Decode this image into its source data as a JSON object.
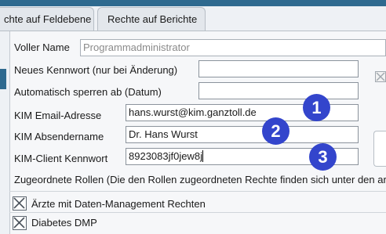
{
  "tabs": [
    {
      "label": "chte auf Feldebene"
    },
    {
      "label": "Rechte auf Berichte"
    }
  ],
  "form": {
    "voller_name": {
      "label": "Voller Name",
      "value": "Programmadministrator"
    },
    "neues_kennwort": {
      "label": "Neues Kennwort (nur bei Änderung)",
      "value": ""
    },
    "automatisch_sperren": {
      "label": "Automatisch sperren ab (Datum)",
      "value": ""
    },
    "kim_email": {
      "label": "KIM Email-Adresse",
      "value": "hans.wurst@kim.ganztoll.de"
    },
    "kim_absendername": {
      "label": "KIM Absendername",
      "value": "Dr. Hans Wurst"
    },
    "kim_client_kennwort": {
      "label": "KIM-Client Kennwort",
      "value": "8923083jf0jew8j"
    }
  },
  "roles": {
    "heading": "Zugeordnete Rollen (Die den Rollen zugeordneten Rechte finden sich unter den ar",
    "items": [
      {
        "label": "Ärzte mit Daten-Management Rechten",
        "checked": true
      },
      {
        "label": "Diabetes DMP",
        "checked": true
      }
    ]
  },
  "annotations": [
    "1",
    "2",
    "3"
  ],
  "colors": {
    "badge": "#3345cc",
    "accent": "#2f6a8f"
  }
}
